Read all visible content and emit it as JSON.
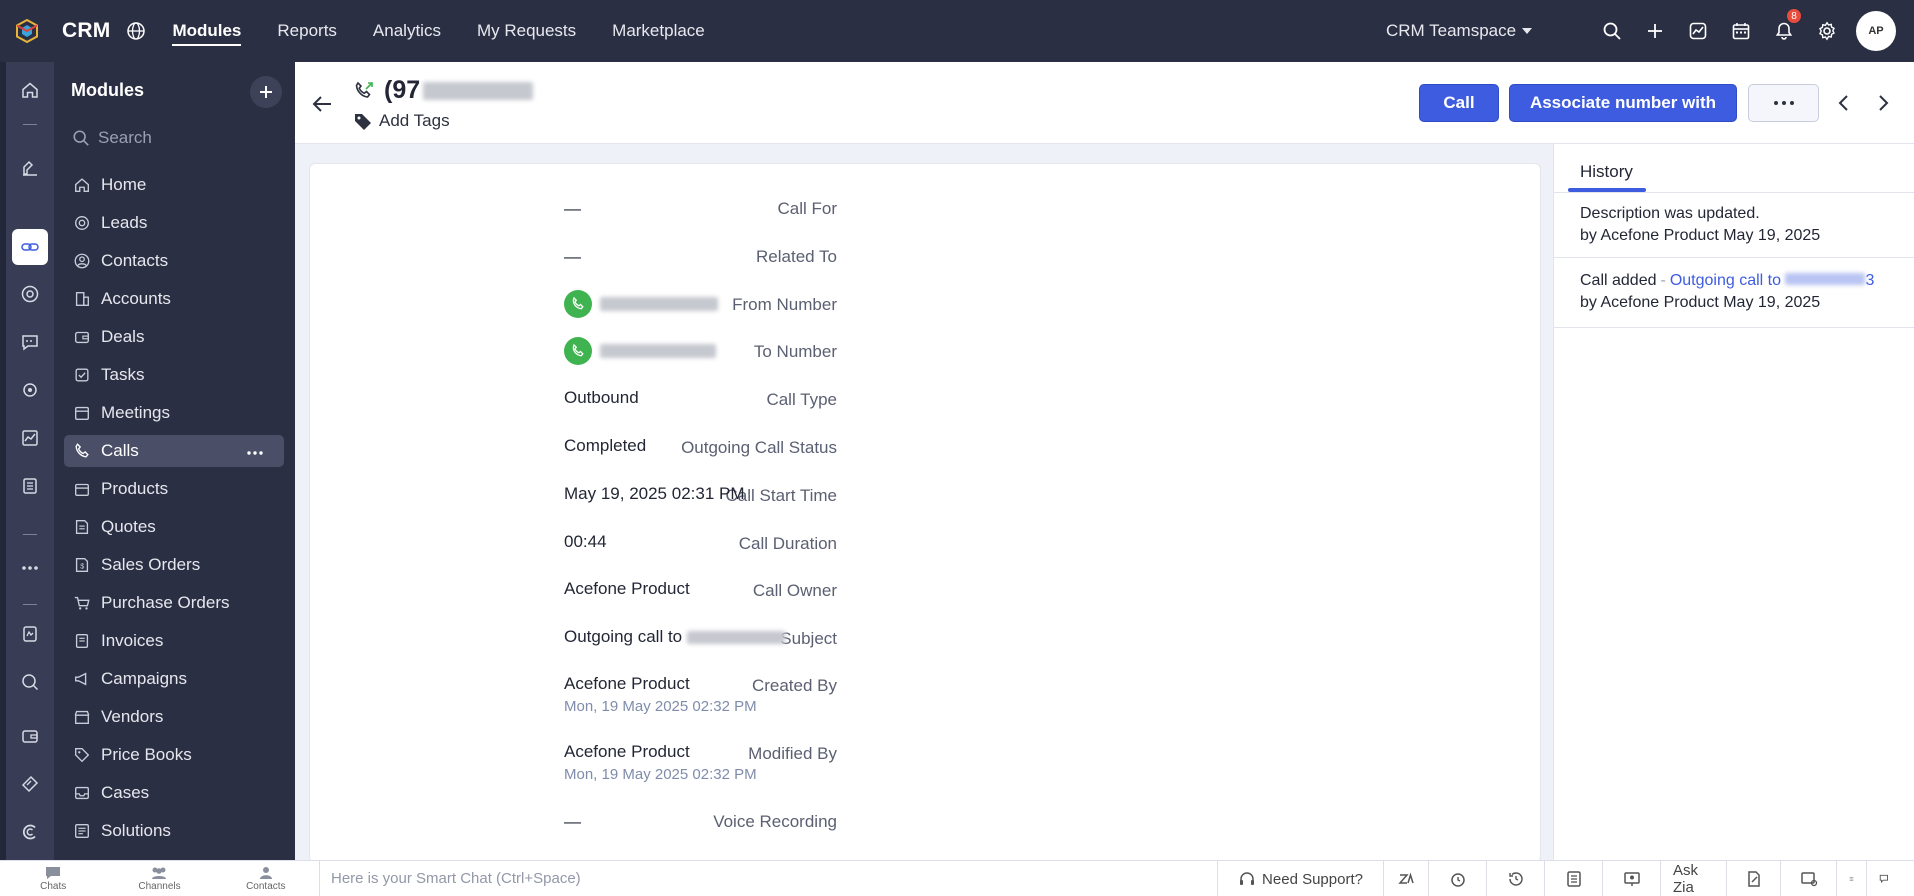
{
  "topbar": {
    "brand": "CRM",
    "nav": [
      "Modules",
      "Reports",
      "Analytics",
      "My Requests",
      "Marketplace"
    ],
    "teamspace": "CRM Teamspace",
    "notification_count": "8",
    "avatar_initials": "AP"
  },
  "sidebar": {
    "title": "Modules",
    "search_placeholder": "Search",
    "items": [
      {
        "label": "Home",
        "icon": "home-icon"
      },
      {
        "label": "Leads",
        "icon": "target-icon"
      },
      {
        "label": "Contacts",
        "icon": "contact-icon"
      },
      {
        "label": "Accounts",
        "icon": "building-icon"
      },
      {
        "label": "Deals",
        "icon": "wallet-icon"
      },
      {
        "label": "Tasks",
        "icon": "task-icon"
      },
      {
        "label": "Meetings",
        "icon": "calendar-icon"
      },
      {
        "label": "Calls",
        "icon": "phone-icon"
      },
      {
        "label": "Products",
        "icon": "box-icon"
      },
      {
        "label": "Quotes",
        "icon": "quote-icon"
      },
      {
        "label": "Sales Orders",
        "icon": "sales-order-icon"
      },
      {
        "label": "Purchase Orders",
        "icon": "cart-icon"
      },
      {
        "label": "Invoices",
        "icon": "invoice-icon"
      },
      {
        "label": "Campaigns",
        "icon": "megaphone-icon"
      },
      {
        "label": "Vendors",
        "icon": "store-icon"
      },
      {
        "label": "Price Books",
        "icon": "tag-icon"
      },
      {
        "label": "Cases",
        "icon": "inbox-icon"
      },
      {
        "label": "Solutions",
        "icon": "solution-icon"
      }
    ],
    "active_item": "Calls"
  },
  "record": {
    "title_visible": "(97",
    "add_tags": "Add Tags",
    "buttons": {
      "call": "Call",
      "associate": "Associate number with"
    }
  },
  "details": {
    "call_for": {
      "label": "Call For",
      "value": "—"
    },
    "related_to": {
      "label": "Related To",
      "value": "—"
    },
    "from_number": {
      "label": "From Number"
    },
    "to_number": {
      "label": "To Number"
    },
    "call_type": {
      "label": "Call Type",
      "value": "Outbound"
    },
    "call_status": {
      "label": "Outgoing Call Status",
      "value": "Completed"
    },
    "start_time": {
      "label": "Call Start Time",
      "value": "May 19, 2025 02:31 PM"
    },
    "duration": {
      "label": "Call Duration",
      "value": "00:44"
    },
    "owner": {
      "label": "Call Owner",
      "value": "Acefone Product"
    },
    "subject": {
      "label": "Subject",
      "value": "Outgoing call to"
    },
    "created_by": {
      "label": "Created By",
      "value": "Acefone Product",
      "sub": "Mon, 19 May 2025 02:32 PM"
    },
    "modified_by": {
      "label": "Modified By",
      "value": "Acefone Product",
      "sub": "Mon, 19 May 2025 02:32 PM"
    },
    "voice_recording": {
      "label": "Voice Recording",
      "value": "—"
    }
  },
  "history": {
    "tab": "History",
    "entries": [
      {
        "line1": "Description was updated.",
        "by": "by Acefone Product",
        "date": "May 19, 2025"
      },
      {
        "line1": "Call added",
        "sep": "-",
        "link": "Outgoing call to",
        "link_tail": "3",
        "by": "by Acefone Product",
        "date": "May 19, 2025"
      }
    ]
  },
  "bottombar": {
    "tabs": [
      "Chats",
      "Channels",
      "Contacts"
    ],
    "smart_chat_placeholder": "Here is your Smart Chat (Ctrl+Space)",
    "need_support": "Need Support?",
    "ask_zia": "Ask Zia"
  },
  "colors": {
    "topbar": "#2b2f43",
    "accent": "#3d5ce0",
    "phone_green": "#3fb34f",
    "badge": "#e84c3d"
  }
}
